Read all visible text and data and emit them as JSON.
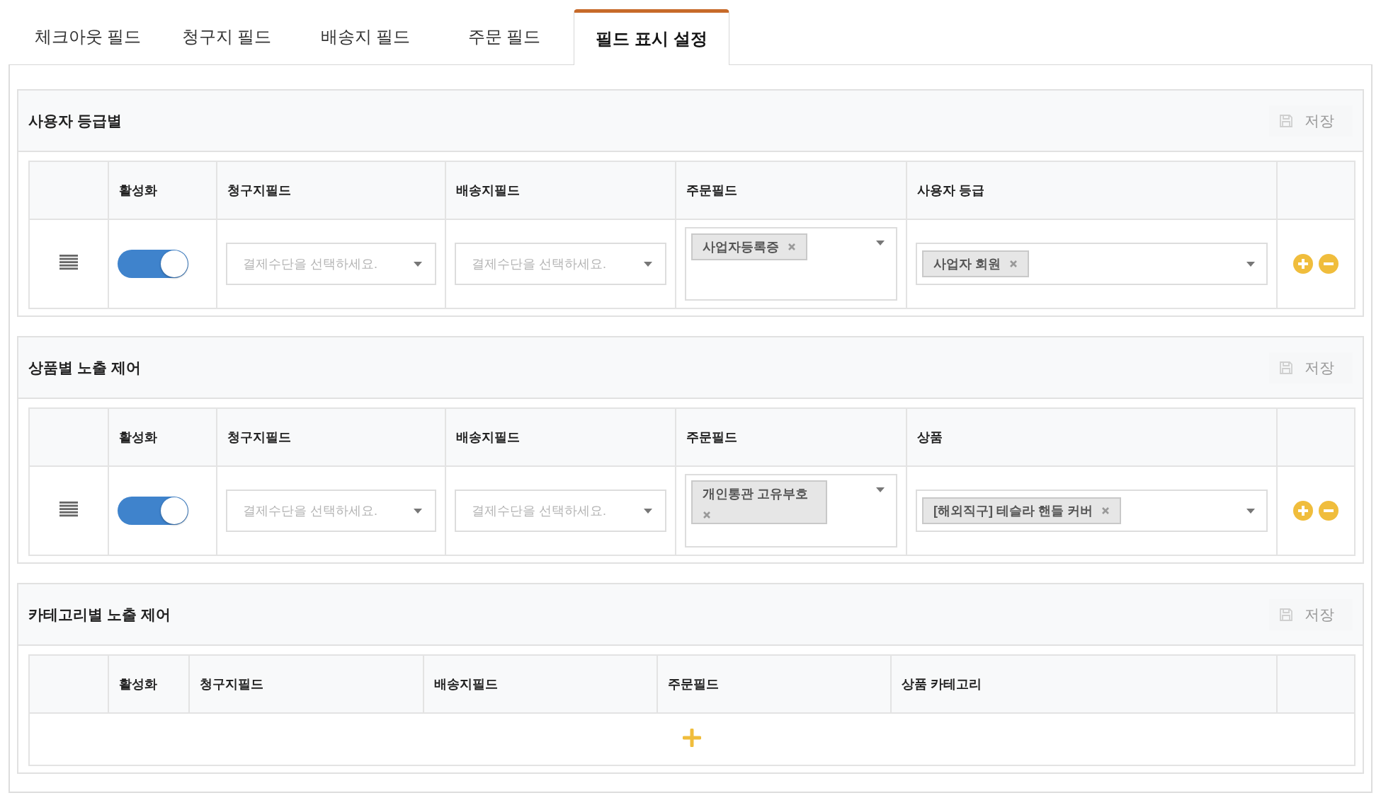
{
  "tabs": [
    {
      "label": "체크아웃 필드",
      "selected": false
    },
    {
      "label": "청구지 필드",
      "selected": false
    },
    {
      "label": "배송지 필드",
      "selected": false
    },
    {
      "label": "주문 필드",
      "selected": false
    },
    {
      "label": "필드 표시 설정",
      "selected": true
    }
  ],
  "sections": [
    {
      "title": "사용자 등급별",
      "save_label": "저장",
      "columns": [
        "활성화",
        "청구지필드",
        "배송지필드",
        "주문필드",
        "사용자 등급"
      ],
      "rows": [
        {
          "on": true,
          "billing_placeholder": "결제수단을 선택하세요.",
          "shipping_placeholder": "결제수단을 선택하세요.",
          "order_tags": [
            "사업자등록증"
          ],
          "target_tags": [
            "사업자 회원"
          ]
        }
      ]
    },
    {
      "title": "상품별 노출 제어",
      "save_label": "저장",
      "columns": [
        "활성화",
        "청구지필드",
        "배송지필드",
        "주문필드",
        "상품"
      ],
      "rows": [
        {
          "on": true,
          "billing_placeholder": "결제수단을 선택하세요.",
          "shipping_placeholder": "결제수단을 선택하세요.",
          "order_tags": [
            "개인통관 고유부호"
          ],
          "target_tags": [
            "[해외직구] 테슬라 핸들 커버"
          ]
        }
      ]
    },
    {
      "title": "카테고리별 노출 제어",
      "save_label": "저장",
      "columns": [
        "활성화",
        "청구지필드",
        "배송지필드",
        "주문필드",
        "상품 카테고리"
      ]
    }
  ]
}
